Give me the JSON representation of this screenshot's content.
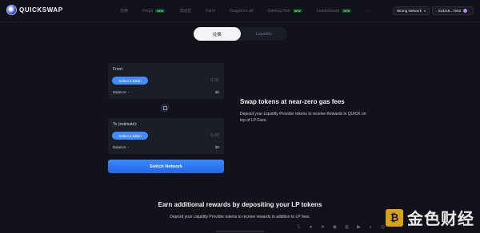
{
  "header": {
    "logo_text": "QUICKSWAP",
    "nav": [
      {
        "label": "兑换",
        "badge": ""
      },
      {
        "label": "Perps",
        "badge": "NEW"
      },
      {
        "label": "流动性",
        "badge": ""
      },
      {
        "label": "Farm",
        "badge": ""
      },
      {
        "label": "Dragon's Lair",
        "badge": ""
      },
      {
        "label": "Gaming Hub",
        "badge": "NEW"
      },
      {
        "label": "Leaderboard",
        "badge": "NEW"
      },
      {
        "label": "···",
        "badge": ""
      }
    ],
    "network_button": "Wrong Network",
    "wallet_address": "0x32c8...7e63"
  },
  "tabs": [
    {
      "label": "兑换",
      "active": true
    },
    {
      "label": "Liquidity",
      "active": false
    }
  ],
  "swap": {
    "from": {
      "label": "From:",
      "select_label": "Select a token",
      "amount_placeholder": "0.00",
      "balance": "Balance: -",
      "usd": "$0"
    },
    "to": {
      "label": "To (estimate):",
      "select_label": "Select a token",
      "amount_placeholder": "0.00",
      "balance": "Balance: -",
      "usd": "$0"
    },
    "action_button": "Switch Network"
  },
  "info": {
    "title": "Swap tokens at near-zero gas fees",
    "text": "Deposit your Liquidity Provider tokens to receive Rewards in QUICK on top of LP Fees."
  },
  "rewards": {
    "title": "Earn additional rewards by depositing your LP tokens",
    "text": "Deposit your Liquidity Provider tokens to receive rewards in addition to LP fees."
  },
  "footer_icons": [
    "x-icon",
    "medium-icon",
    "telegram-icon",
    "discord-icon",
    "reddit-icon",
    "youtube-icon",
    "coingecko-icon",
    "coinmarketcap-icon"
  ],
  "watermark": {
    "mark": "₿",
    "text": "金色财经"
  },
  "colors": {
    "background": "#12131a",
    "card": "#1b1e27",
    "accent": "#448aff",
    "badge": "#5cf070",
    "watermark": "#d8a31a"
  }
}
